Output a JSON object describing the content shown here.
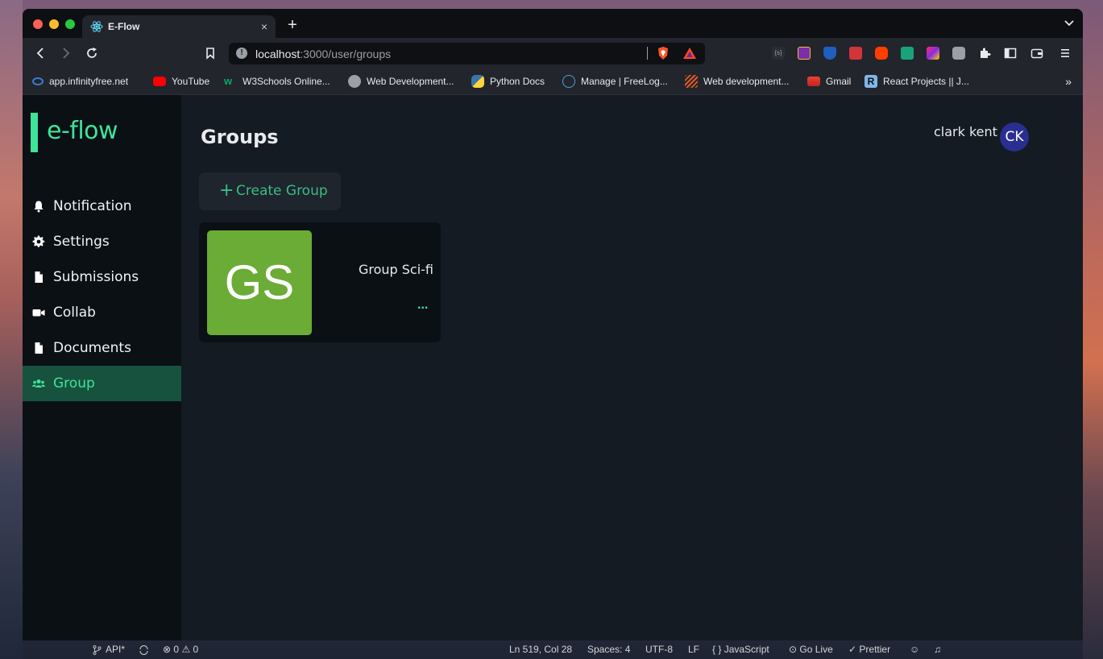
{
  "browser": {
    "tab_title": "E-Flow",
    "tab_close": "×",
    "new_tab": "+",
    "url_host": "localhost",
    "url_path": ":3000/user/groups",
    "bookmarks": [
      {
        "label": "app.infinityfree.net",
        "icon": "infinityfree-icon",
        "color": "#3a7bd5"
      },
      {
        "label": "YouTube",
        "icon": "youtube-icon",
        "color": "#ff0000"
      },
      {
        "label": "W3Schools Online...",
        "icon": "w3schools-icon",
        "color": "#04aa6d"
      },
      {
        "label": "Web Development...",
        "icon": "globe-icon",
        "color": "#9aa0a6"
      },
      {
        "label": "Python Docs",
        "icon": "python-icon",
        "color": "#3776ab"
      },
      {
        "label": "Manage | FreeLog...",
        "icon": "freelogo-icon",
        "color": "#4aa3df"
      },
      {
        "label": "Web development...",
        "icon": "stripes-icon",
        "color": "#e25822"
      },
      {
        "label": "Gmail",
        "icon": "gmail-icon",
        "color": "#ea4335"
      },
      {
        "label": "React Projects || J...",
        "icon": "r-icon",
        "color": "#7fb6e8"
      }
    ],
    "bookmarks_more": "»"
  },
  "app": {
    "logo": "e-flow",
    "page_title": "Groups",
    "user_name": "clark kent",
    "user_initials": "CK",
    "accent": "#3ee49a",
    "nav": [
      {
        "label": "Notification",
        "icon": "bell-icon"
      },
      {
        "label": "Settings",
        "icon": "gear-icon"
      },
      {
        "label": "Submissions",
        "icon": "file-icon"
      },
      {
        "label": "Collab",
        "icon": "video-icon"
      },
      {
        "label": "Documents",
        "icon": "file-icon"
      },
      {
        "label": "Group",
        "icon": "users-icon",
        "active": true
      }
    ],
    "create_group": {
      "plus": "+",
      "label": "Create Group"
    },
    "groups": [
      {
        "initials": "GS",
        "name": "Group Sci-fi",
        "more": "...",
        "color": "#6aac35"
      }
    ]
  },
  "statusbar": {
    "branch": "API*",
    "problems": "0",
    "warnings": "0",
    "position": "Ln 519, Col 28",
    "spaces": "Spaces: 4",
    "encoding": "UTF-8",
    "eol": "LF",
    "language": "JavaScript",
    "go_live": "Go Live",
    "prettier": "Prettier"
  }
}
